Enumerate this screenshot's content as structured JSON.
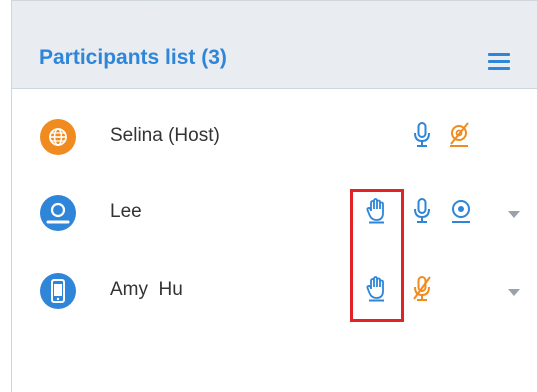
{
  "panel": {
    "title": "Participants list (3)",
    "menu_icon": "hamburger-menu-icon"
  },
  "participants": [
    {
      "name": "Selina (Host)",
      "avatar_icon": "globe-icon",
      "avatar_color": "#f08c1f",
      "hand_raised": false,
      "mic": "on",
      "camera": "off",
      "has_dropdown": false
    },
    {
      "name": "Lee",
      "avatar_icon": "user-icon",
      "avatar_color": "#2f86d9",
      "hand_raised": true,
      "mic": "on",
      "camera": "on",
      "has_dropdown": true
    },
    {
      "name": "Amy  Hu",
      "avatar_icon": "phone-icon",
      "avatar_color": "#2f86d9",
      "hand_raised": true,
      "mic": "off",
      "camera": "none",
      "has_dropdown": true
    }
  ],
  "colors": {
    "accent": "#2f86d9",
    "muted": "#f08c1f",
    "highlight_box": "#e02424",
    "header_bg": "#e9ecf0"
  }
}
